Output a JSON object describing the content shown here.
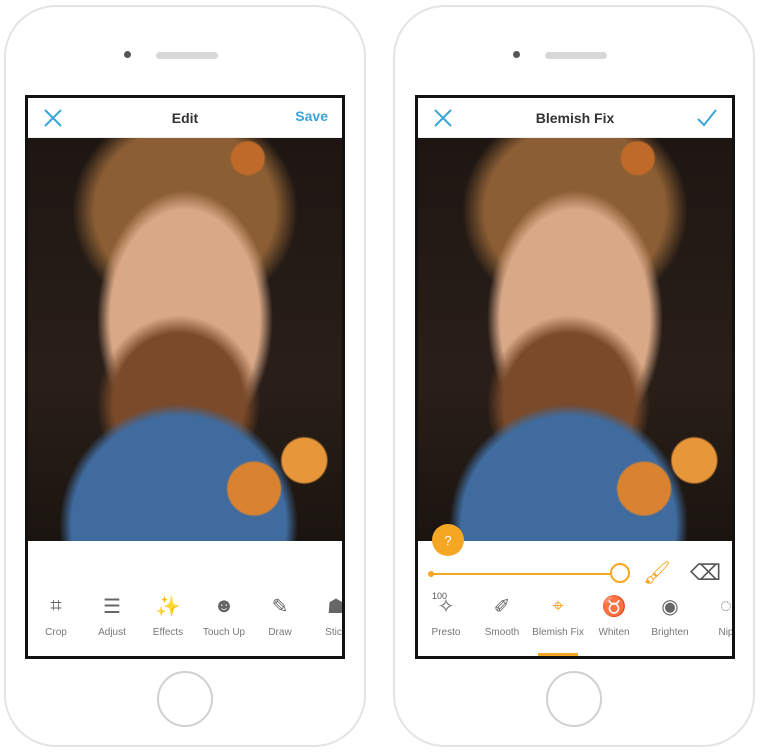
{
  "colors": {
    "accent_blue": "#3aa6d9",
    "accent_orange": "#f5a623"
  },
  "left": {
    "header": {
      "title": "Edit",
      "close_icon": "close-icon",
      "save_label": "Save"
    },
    "tools": [
      {
        "label": "Crop",
        "icon": "crop-icon"
      },
      {
        "label": "Adjust",
        "icon": "sliders-icon"
      },
      {
        "label": "Effects",
        "icon": "magic-wand-icon"
      },
      {
        "label": "Touch Up",
        "icon": "face-icon"
      },
      {
        "label": "Draw",
        "icon": "pencil-icon"
      },
      {
        "label": "Stick",
        "icon": "ghost-icon"
      }
    ]
  },
  "right": {
    "header": {
      "title": "Blemish Fix",
      "close_icon": "close-icon",
      "confirm_icon": "check-icon"
    },
    "help_label": "?",
    "slider": {
      "value": "100",
      "fraction": 1.0
    },
    "tools": [
      {
        "label": "Presto",
        "icon": "sparkle-face-icon"
      },
      {
        "label": "Smooth",
        "icon": "brush-icon"
      },
      {
        "label": "Blemish Fix",
        "icon": "crosshair-icon",
        "selected": true
      },
      {
        "label": "Whiten",
        "icon": "tooth-icon"
      },
      {
        "label": "Brighten",
        "icon": "eye-icon"
      },
      {
        "label": "Nip",
        "icon": "nip-icon"
      }
    ]
  }
}
